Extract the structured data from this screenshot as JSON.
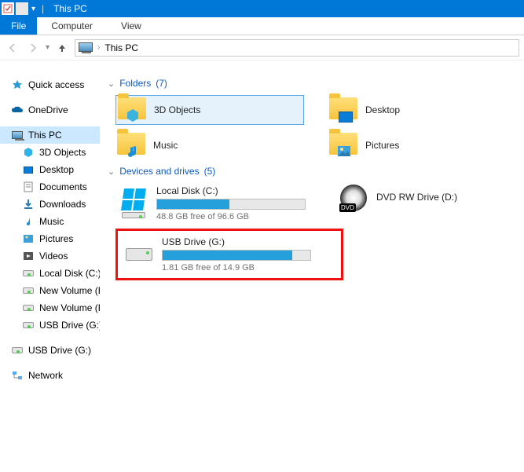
{
  "title": "This PC",
  "ribbon": {
    "file": "File",
    "computer": "Computer",
    "view": "View"
  },
  "breadcrumb": {
    "location": "This PC"
  },
  "sidebar": {
    "quick_access": "Quick access",
    "onedrive": "OneDrive",
    "this_pc": "This PC",
    "items": [
      "3D Objects",
      "Desktop",
      "Documents",
      "Downloads",
      "Music",
      "Pictures",
      "Videos",
      "Local Disk (C:)",
      "New Volume (E:)",
      "New Volume (F:)",
      "USB Drive (G:)"
    ],
    "usb_detached": "USB Drive (G:)",
    "network": "Network"
  },
  "groups": {
    "folders": {
      "label": "Folders",
      "count": "(7)"
    },
    "drives": {
      "label": "Devices and drives",
      "count": "(5)"
    }
  },
  "folders": [
    {
      "name": "3D Objects",
      "selected": true
    },
    {
      "name": "Desktop"
    },
    {
      "name": "Music"
    },
    {
      "name": "Pictures"
    }
  ],
  "drives": [
    {
      "name": "Local Disk (C:)",
      "free": "48.8 GB free of 96.6 GB",
      "fill_pct": 49,
      "icon": "windows"
    },
    {
      "name": "DVD RW Drive (D:)",
      "type": "dvd"
    },
    {
      "name": "USB Drive (G:)",
      "free": "1.81 GB free of 14.9 GB",
      "fill_pct": 88,
      "icon": "hdd",
      "highlighted": true
    }
  ]
}
